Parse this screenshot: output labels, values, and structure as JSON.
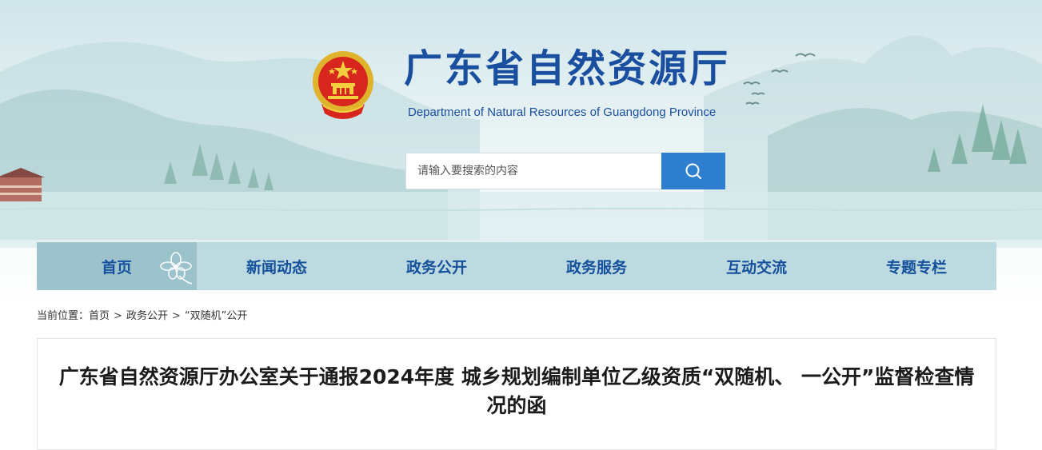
{
  "header": {
    "title": "广东省自然资源厅",
    "subtitle": "Department of Natural Resources of Guangdong Province",
    "emblem_icon": "national-emblem-icon"
  },
  "search": {
    "placeholder": "请输入要搜索的内容",
    "value": "",
    "button_icon": "search-icon"
  },
  "nav": {
    "items": [
      {
        "label": "首页",
        "active": true
      },
      {
        "label": "新闻动态",
        "active": false
      },
      {
        "label": "政务公开",
        "active": false
      },
      {
        "label": "政务服务",
        "active": false
      },
      {
        "label": "互动交流",
        "active": false
      },
      {
        "label": "专题专栏",
        "active": false
      }
    ]
  },
  "breadcrumb": {
    "prefix": "当前位置：",
    "items": [
      "首页",
      "政务公开",
      "“双随机”公开"
    ],
    "separator": ">"
  },
  "article": {
    "title": "广东省自然资源厅办公室关于通报2024年度 城乡规划编制单位乙级资质“双随机、 一公开”监督检查情况的函"
  },
  "colors": {
    "brand_blue": "#1a4fa0",
    "search_button": "#2f7fd0",
    "nav_bg": "#b7d7de",
    "nav_active": "#9cc3cc",
    "nav_text": "#14509b"
  }
}
